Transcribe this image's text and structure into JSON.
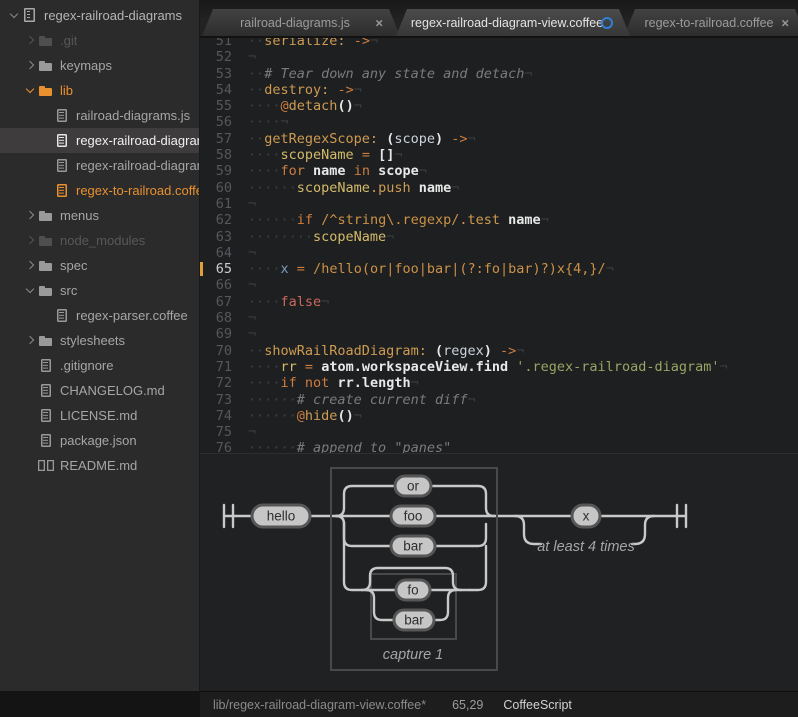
{
  "sidebar": {
    "items": [
      {
        "label": "regex-railroad-diagrams",
        "kind": "root",
        "depth": 0,
        "expanded": true,
        "state": "root"
      },
      {
        "label": ".git",
        "kind": "folder",
        "depth": 1,
        "expanded": false,
        "state": "dimmed"
      },
      {
        "label": "keymaps",
        "kind": "folder",
        "depth": 1,
        "expanded": false,
        "state": "normal"
      },
      {
        "label": "lib",
        "kind": "folder",
        "depth": 1,
        "expanded": true,
        "state": "accent"
      },
      {
        "label": "railroad-diagrams.js",
        "kind": "file",
        "depth": 2,
        "state": "normal"
      },
      {
        "label": "regex-railroad-diagram-view.coffee",
        "kind": "file",
        "depth": 2,
        "state": "selected"
      },
      {
        "label": "regex-railroad-diagram.coffee",
        "kind": "file",
        "depth": 2,
        "state": "normal"
      },
      {
        "label": "regex-to-railroad.coffee",
        "kind": "file",
        "depth": 2,
        "state": "accent"
      },
      {
        "label": "menus",
        "kind": "folder",
        "depth": 1,
        "expanded": false,
        "state": "normal"
      },
      {
        "label": "node_modules",
        "kind": "folder",
        "depth": 1,
        "expanded": false,
        "state": "dimmed"
      },
      {
        "label": "spec",
        "kind": "folder",
        "depth": 1,
        "expanded": false,
        "state": "normal"
      },
      {
        "label": "src",
        "kind": "folder",
        "depth": 1,
        "expanded": true,
        "state": "normal"
      },
      {
        "label": "regex-parser.coffee",
        "kind": "file",
        "depth": 2,
        "state": "normal"
      },
      {
        "label": "stylesheets",
        "kind": "folder",
        "depth": 1,
        "expanded": false,
        "state": "normal"
      },
      {
        "label": ".gitignore",
        "kind": "file",
        "depth": 1,
        "state": "normal"
      },
      {
        "label": "CHANGELOG.md",
        "kind": "file",
        "depth": 1,
        "state": "normal"
      },
      {
        "label": "LICENSE.md",
        "kind": "file",
        "depth": 1,
        "state": "normal"
      },
      {
        "label": "package.json",
        "kind": "file",
        "depth": 1,
        "state": "normal"
      },
      {
        "label": "README.md",
        "kind": "readme",
        "depth": 1,
        "state": "normal"
      }
    ]
  },
  "tabs": {
    "close_glyph": "×",
    "items": [
      {
        "label": "railroad-diagrams.js",
        "active": false,
        "modified": false
      },
      {
        "label": "regex-railroad-diagram-view.coffee",
        "active": true,
        "modified": true
      },
      {
        "label": "regex-to-railroad.coffee",
        "active": false,
        "modified": false
      }
    ]
  },
  "editor": {
    "cursor_line": 65,
    "lines": [
      {
        "n": 51,
        "s": [
          [
            "ws",
            "··"
          ],
          [
            "fn",
            "serialize:"
          ],
          [
            "pl",
            " "
          ],
          [
            "kw",
            "->"
          ],
          [
            "eol",
            "¬"
          ]
        ]
      },
      {
        "n": 52,
        "s": [
          [
            "eol",
            "¬"
          ]
        ]
      },
      {
        "n": 53,
        "s": [
          [
            "ws",
            "··"
          ],
          [
            "cm",
            "# Tear down any state and detach"
          ],
          [
            "eol",
            "¬"
          ]
        ]
      },
      {
        "n": 54,
        "s": [
          [
            "ws",
            "··"
          ],
          [
            "fn",
            "destroy:"
          ],
          [
            "pl",
            " "
          ],
          [
            "kw",
            "->"
          ],
          [
            "eol",
            "¬"
          ]
        ]
      },
      {
        "n": 55,
        "s": [
          [
            "ws",
            "····"
          ],
          [
            "kw",
            "@"
          ],
          [
            "fn",
            "detach"
          ],
          [
            "pb",
            "()"
          ],
          [
            "eol",
            "¬"
          ]
        ]
      },
      {
        "n": 56,
        "s": [
          [
            "ws",
            "····"
          ],
          [
            "eol",
            "¬"
          ]
        ]
      },
      {
        "n": 57,
        "s": [
          [
            "ws",
            "··"
          ],
          [
            "fn",
            "getRegexScope:"
          ],
          [
            "pl",
            " "
          ],
          [
            "pb",
            "("
          ],
          [
            "pm",
            "scope"
          ],
          [
            "pb",
            ")"
          ],
          [
            "pl",
            " "
          ],
          [
            "kw",
            "->"
          ],
          [
            "eol",
            "¬"
          ]
        ]
      },
      {
        "n": 58,
        "s": [
          [
            "ws",
            "····"
          ],
          [
            "var",
            "scopeName"
          ],
          [
            "pl",
            " "
          ],
          [
            "kw",
            "="
          ],
          [
            "pl",
            " "
          ],
          [
            "pb",
            "[]"
          ],
          [
            "eol",
            "¬"
          ]
        ]
      },
      {
        "n": 59,
        "s": [
          [
            "ws",
            "····"
          ],
          [
            "kw",
            "for"
          ],
          [
            "pl",
            " "
          ],
          [
            "id",
            "name"
          ],
          [
            "pl",
            " "
          ],
          [
            "kw",
            "in"
          ],
          [
            "pl",
            " "
          ],
          [
            "id",
            "scope"
          ],
          [
            "eol",
            "¬"
          ]
        ]
      },
      {
        "n": 60,
        "s": [
          [
            "ws",
            "······"
          ],
          [
            "var",
            "scopeName"
          ],
          [
            "fn",
            ".push"
          ],
          [
            "pl",
            " "
          ],
          [
            "id",
            "name"
          ],
          [
            "eol",
            "¬"
          ]
        ]
      },
      {
        "n": 61,
        "s": [
          [
            "eol",
            "¬"
          ]
        ]
      },
      {
        "n": 62,
        "s": [
          [
            "ws",
            "······"
          ],
          [
            "kw",
            "if"
          ],
          [
            "pl",
            " "
          ],
          [
            "rx",
            "/^string\\.regexp/"
          ],
          [
            "fn",
            ".test"
          ],
          [
            "pl",
            " "
          ],
          [
            "id",
            "name"
          ],
          [
            "eol",
            "¬"
          ]
        ]
      },
      {
        "n": 63,
        "s": [
          [
            "ws",
            "········"
          ],
          [
            "var",
            "scopeName"
          ],
          [
            "eol",
            "¬"
          ]
        ]
      },
      {
        "n": 64,
        "s": [
          [
            "eol",
            "¬"
          ]
        ]
      },
      {
        "n": 65,
        "s": [
          [
            "ws",
            "····"
          ],
          [
            "blue",
            "x"
          ],
          [
            "pl",
            " "
          ],
          [
            "kw",
            "="
          ],
          [
            "pl",
            " "
          ],
          [
            "rx",
            "/hello(or|foo|bar|(?:fo|bar)?)x{4,}/"
          ],
          [
            "eol",
            "¬"
          ]
        ]
      },
      {
        "n": 66,
        "s": [
          [
            "eol",
            "¬"
          ]
        ]
      },
      {
        "n": 67,
        "s": [
          [
            "ws",
            "····"
          ],
          [
            "red",
            "false"
          ],
          [
            "eol",
            "¬"
          ]
        ]
      },
      {
        "n": 68,
        "s": [
          [
            "eol",
            "¬"
          ]
        ]
      },
      {
        "n": 69,
        "s": [
          [
            "eol",
            "¬"
          ]
        ]
      },
      {
        "n": 70,
        "s": [
          [
            "ws",
            "··"
          ],
          [
            "fn",
            "showRailRoadDiagram:"
          ],
          [
            "pl",
            " "
          ],
          [
            "pb",
            "("
          ],
          [
            "pm",
            "regex"
          ],
          [
            "pb",
            ")"
          ],
          [
            "pl",
            " "
          ],
          [
            "kw",
            "->"
          ],
          [
            "eol",
            "¬"
          ]
        ]
      },
      {
        "n": 71,
        "s": [
          [
            "ws",
            "····"
          ],
          [
            "var",
            "rr"
          ],
          [
            "pl",
            " "
          ],
          [
            "kw",
            "="
          ],
          [
            "pl",
            " "
          ],
          [
            "id",
            "atom.workspaceView.find"
          ],
          [
            "pl",
            " "
          ],
          [
            "str",
            "'.regex-railroad-diagram'"
          ],
          [
            "eol",
            "¬"
          ]
        ]
      },
      {
        "n": 72,
        "s": [
          [
            "ws",
            "····"
          ],
          [
            "kw",
            "if"
          ],
          [
            "pl",
            " "
          ],
          [
            "kw",
            "not"
          ],
          [
            "pl",
            " "
          ],
          [
            "id",
            "rr.length"
          ],
          [
            "eol",
            "¬"
          ]
        ]
      },
      {
        "n": 73,
        "s": [
          [
            "ws",
            "······"
          ],
          [
            "cm",
            "# create current diff"
          ],
          [
            "eol",
            "¬"
          ]
        ]
      },
      {
        "n": 74,
        "s": [
          [
            "ws",
            "······"
          ],
          [
            "kw",
            "@"
          ],
          [
            "fn",
            "hide"
          ],
          [
            "pb",
            "()"
          ],
          [
            "eol",
            "¬"
          ]
        ]
      },
      {
        "n": 75,
        "s": [
          [
            "eol",
            "¬"
          ]
        ]
      },
      {
        "n": 76,
        "s": [
          [
            "ws",
            "······"
          ],
          [
            "cm",
            "# append to \"panes\""
          ]
        ]
      }
    ]
  },
  "diagram": {
    "nodes": {
      "hello": "hello",
      "or": "or",
      "foo": "foo",
      "bar": "bar",
      "fo": "fo",
      "bar2": "bar",
      "x": "x"
    },
    "captions": {
      "group": "capture 1",
      "repeat": "at least 4 times"
    }
  },
  "status": {
    "file": "lib/regex-railroad-diagram-view.coffee*",
    "position": "65,29",
    "grammar": "CoffeeScript"
  },
  "colors": {
    "accent_orange": "#e9912e",
    "modified_blue": "#2f7fd4",
    "selection_bg": "#3e3c3c",
    "editor_bg": "#1d1f21",
    "sidebar_bg": "#2b2b2b"
  }
}
